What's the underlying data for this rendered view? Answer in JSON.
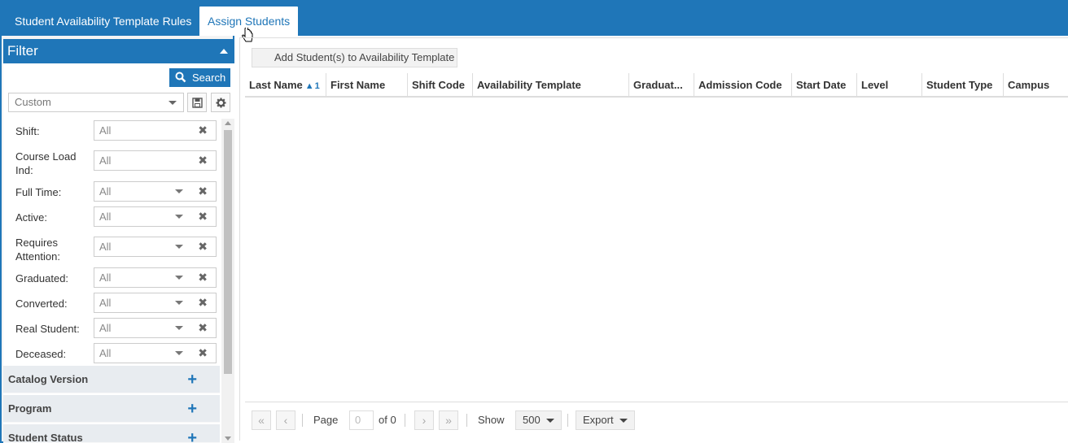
{
  "tabs": [
    {
      "label": "Student Availability Template Rules"
    },
    {
      "label": "Assign Students"
    }
  ],
  "filter": {
    "title": "Filter",
    "search_label": "Search",
    "preset_value": "Custom",
    "rows": [
      {
        "label": "Shift:",
        "value": "All"
      },
      {
        "label": "Course Load Ind:",
        "value": "All"
      },
      {
        "label": "Full Time:",
        "value": "All"
      },
      {
        "label": "Active:",
        "value": "All"
      },
      {
        "label": "Requires Attention:",
        "value": "All"
      },
      {
        "label": "Graduated:",
        "value": "All"
      },
      {
        "label": "Converted:",
        "value": "All"
      },
      {
        "label": "Real Student:",
        "value": "All"
      },
      {
        "label": "Deceased:",
        "value": "All"
      }
    ],
    "sections": [
      {
        "label": "Catalog Version"
      },
      {
        "label": "Program"
      },
      {
        "label": "Student Status"
      }
    ]
  },
  "grid": {
    "add_button": "Add Student(s) to Availability Template",
    "columns": [
      {
        "label": "Last Name",
        "sort": "1"
      },
      {
        "label": "First Name"
      },
      {
        "label": "Shift Code"
      },
      {
        "label": "Availability Template"
      },
      {
        "label": "Graduat..."
      },
      {
        "label": "Admission Code"
      },
      {
        "label": "Start Date"
      },
      {
        "label": "Level"
      },
      {
        "label": "Student Type"
      },
      {
        "label": "Campus"
      }
    ]
  },
  "pager": {
    "page_label": "Page",
    "page_value": "0",
    "of_label": "of 0",
    "show_label": "Show",
    "page_size": "500",
    "export_label": "Export"
  }
}
